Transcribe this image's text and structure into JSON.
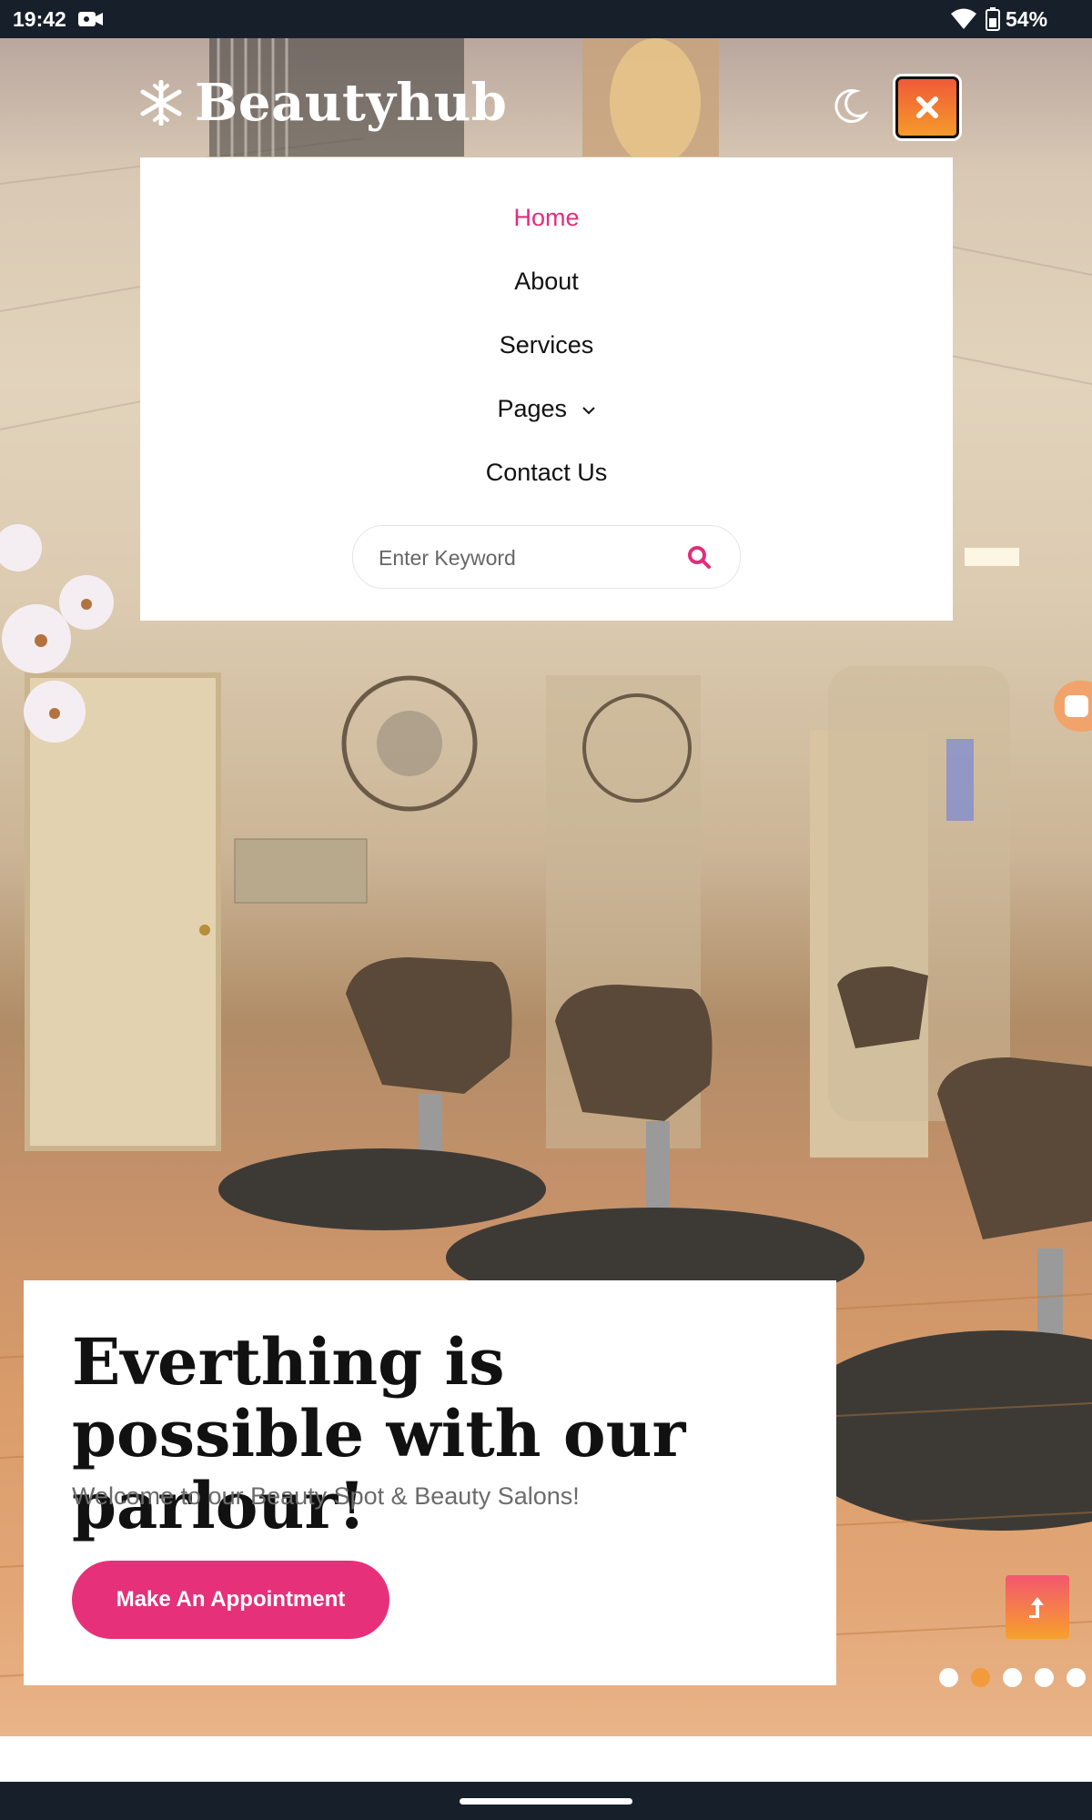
{
  "status_bar": {
    "time": "19:42",
    "battery": "54%",
    "icons": [
      "camera-icon",
      "wifi-icon",
      "battery-icon"
    ]
  },
  "header": {
    "logo_text": "Beautyhub",
    "logo_icon": "snowflake-icon",
    "theme_toggle_icon": "moon-icon",
    "close_icon": "close-icon"
  },
  "menu": {
    "items": [
      {
        "label": "Home",
        "active": true
      },
      {
        "label": "About",
        "active": false
      },
      {
        "label": "Services",
        "active": false
      },
      {
        "label": "Pages",
        "active": false,
        "has_dropdown": true
      },
      {
        "label": "Contact Us",
        "active": false
      }
    ],
    "search": {
      "placeholder": "Enter Keyword",
      "value": ""
    }
  },
  "hero": {
    "title": "Everthing is possible with our parlour!",
    "subtitle": "Welcome to our Beauty Spot & Beauty Salons!",
    "cta_label": "Make An Appointment",
    "slides_total": 5,
    "active_slide": 2
  },
  "colors": {
    "accent_pink": "#e6307a",
    "accent_orange": "#f29b3c",
    "status_bar_bg": "#17202a"
  }
}
